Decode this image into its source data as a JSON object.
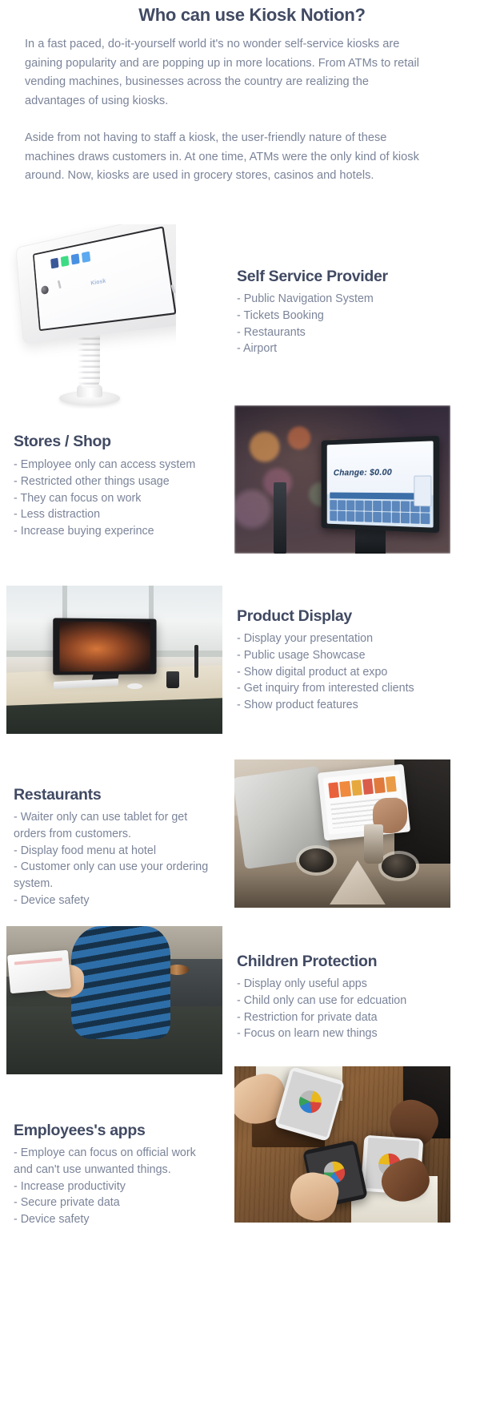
{
  "intro": {
    "title": "Who can use Kiosk Notion?",
    "paragraphs": [
      "In a fast paced, do-it-yourself world it's no wonder self-service kiosks are gaining popularity and are popping up in more locations. From ATMs to retail vending machines, businesses across the country are realizing the advantages of using kiosks.",
      "Aside from not having to staff a kiosk, the user-friendly nature of these machines draws customers in. At one time, ATMs were the only kind of kiosk around. Now, kiosks are used in grocery stores, casinos and hotels."
    ]
  },
  "sections": [
    {
      "id": "self-service-provider",
      "title": "Self Service Provider",
      "items": [
        "- Public Navigation System",
        "- Tickets Booking",
        "- Restaurants",
        "- Airport"
      ],
      "image_name": "kiosk-tablet-stand-photo"
    },
    {
      "id": "stores-shop",
      "title": "Stores / Shop",
      "items": [
        "- Employee only can access system",
        "- Restricted other things usage",
        "- They can focus on work",
        "- Less distraction",
        "- Increase buying experince"
      ],
      "image_name": "store-pos-terminal-photo",
      "image_text": "Change: $0.00"
    },
    {
      "id": "product-display",
      "title": "Product Display",
      "items": [
        "- Display your presentation",
        "- Public usage Showcase",
        "- Show digital product at expo",
        "- Get inquiry from interested clients",
        "- Show product features"
      ],
      "image_name": "desk-monitor-display-photo"
    },
    {
      "id": "restaurants",
      "title": "Restaurants",
      "items": [
        "- Waiter only can use tablet for get orders from customers.",
        "- Display food menu at hotel",
        "- Customer only can use your ordering system.",
        "- Device safety"
      ],
      "image_name": "restaurant-tablet-photo"
    },
    {
      "id": "children-protection",
      "title": "Children Protection",
      "items": [
        "- Display only useful apps",
        "- Child only can use for edcuation",
        "- Restriction for private data",
        "- Focus on learn new things"
      ],
      "image_name": "child-using-tablet-photo"
    },
    {
      "id": "employees-apps",
      "title": "Employees's apps",
      "items": [
        "- Employe can focus on official work and can't use unwanted things.",
        "- Increase productivity",
        "- Secure private data",
        "- Device safety"
      ],
      "image_name": "employees-phones-photo"
    }
  ],
  "colors": {
    "heading": "#414a63",
    "body_text": "#7b8499",
    "background": "#ffffff"
  }
}
